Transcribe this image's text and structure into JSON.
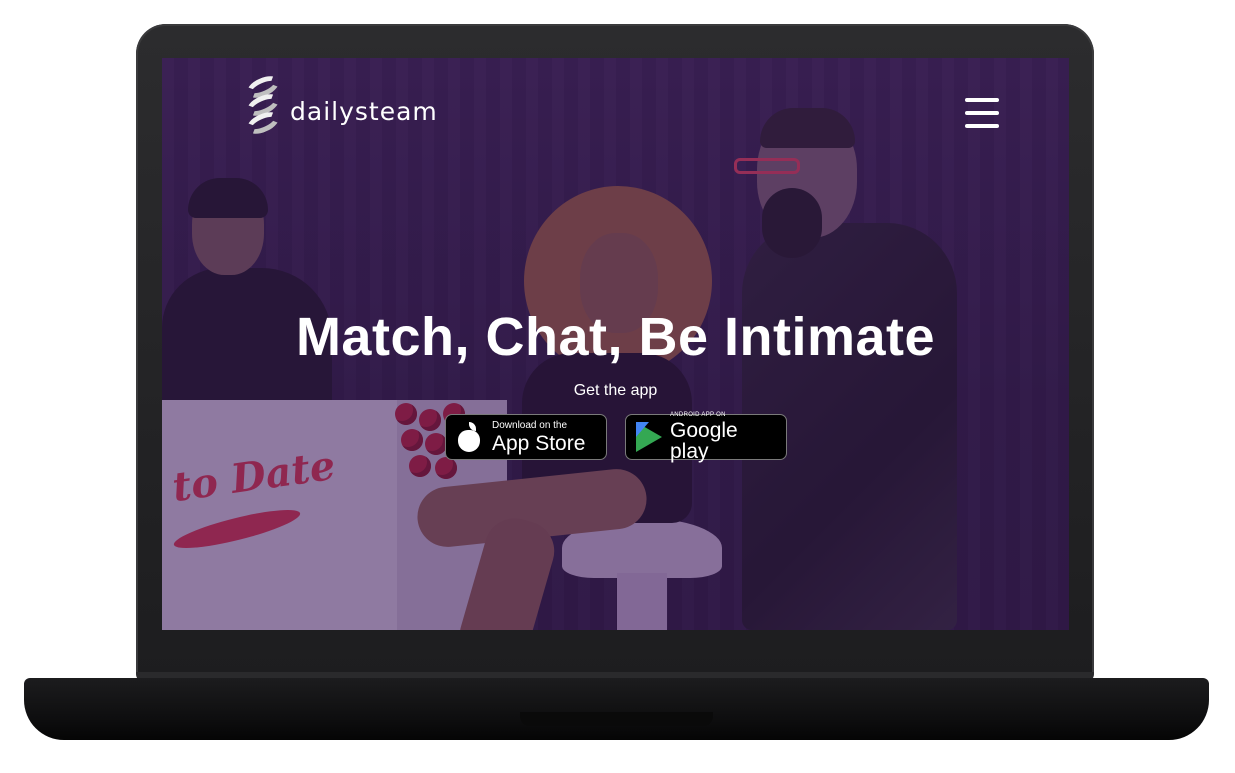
{
  "header": {
    "logo_text": "dailysteam",
    "menu_icon": "hamburger-icon"
  },
  "hero": {
    "title": "Match, Chat, Be Intimate",
    "subtitle": "Get the app"
  },
  "background": {
    "table_sign_text": "to Date"
  },
  "badges": {
    "app_store": {
      "small": "Download on the",
      "big": "App Store",
      "icon": "apple-icon"
    },
    "google_play": {
      "small": "ANDROID APP ON",
      "big": "Google play",
      "icon": "google-play-icon"
    }
  },
  "colors": {
    "overlay": "#381854",
    "accent": "#d8344e"
  }
}
